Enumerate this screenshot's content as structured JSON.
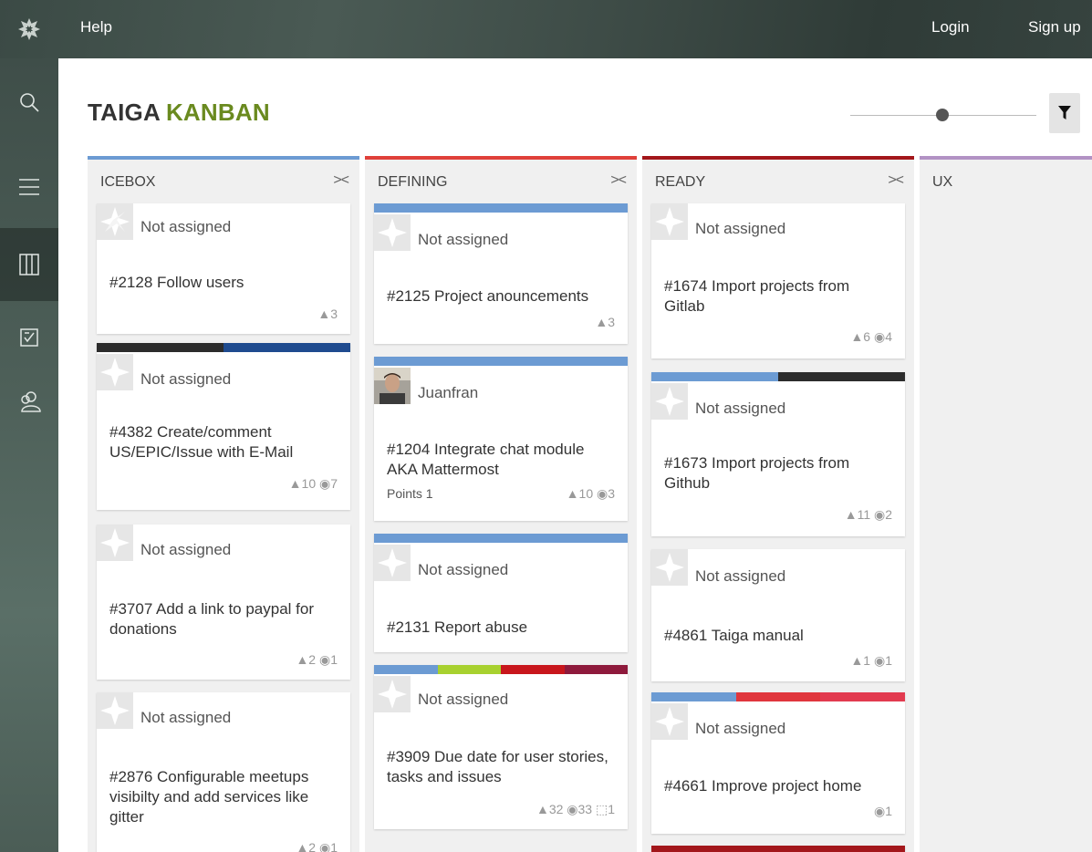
{
  "topbar": {
    "help": "Help",
    "login": "Login",
    "signup": "Sign up"
  },
  "project": {
    "name": "TAIGA",
    "section": "KANBAN"
  },
  "columns": [
    {
      "name": "ICEBOX",
      "color": "#6c9bd3"
    },
    {
      "name": "DEFINING",
      "color": "#e0403a"
    },
    {
      "name": "READY",
      "color": "#a3171b"
    },
    {
      "name": "UX",
      "color": "#b292c4"
    }
  ],
  "fold_symbol": "><",
  "cards": {
    "c1": {
      "assignee": "Not assigned",
      "subject": "#2128 Follow users",
      "stats": "▲3"
    },
    "c2": {
      "assignee": "Not assigned",
      "subject": "#4382 Create/comment US/EPIC/Issue with E-Mail",
      "stats": "▲10 ◉7"
    },
    "c3": {
      "assignee": "Not assigned",
      "subject": "#3707 Add a link to paypal for donations",
      "stats": "▲2 ◉1"
    },
    "c4": {
      "assignee": "Not assigned",
      "subject": "#2876 Configurable meetups visibilty and add services like gitter",
      "stats": "▲2 ◉1"
    },
    "d1": {
      "assignee": "Not assigned",
      "subject": "#2125 Project anouncements",
      "stats": "▲3"
    },
    "d2": {
      "assignee": "Juanfran",
      "subject": "#1204 Integrate chat module AKA Mattermost",
      "points": "Points 1",
      "stats": "▲10 ◉3"
    },
    "d3": {
      "assignee": "Not assigned",
      "subject": "#2131 Report abuse"
    },
    "d4": {
      "assignee": "Not assigned",
      "subject": "#3909 Due date for user stories, tasks and issues",
      "stats": "▲32 ◉33 ⬚1"
    },
    "r1": {
      "assignee": "Not assigned",
      "subject": "#1674 Import projects from Gitlab",
      "stats": "▲6 ◉4"
    },
    "r2": {
      "assignee": "Not assigned",
      "subject": "#1673 Import projects from Github",
      "stats": "▲11 ◉2"
    },
    "r3": {
      "assignee": "Not assigned",
      "subject": "#4861 Taiga manual",
      "stats": "▲1 ◉1"
    },
    "r4": {
      "assignee": "Not assigned",
      "subject": "#4661 Improve project home",
      "stats": "◉1"
    }
  },
  "tag_colors": {
    "blue": "#6c9bd3",
    "dark": "#2c2c2c",
    "navy": "#1f4b8f",
    "lime": "#a8d12f",
    "red": "#c8161c",
    "maroon": "#8e1a3c",
    "bright_red": "#e0363d",
    "pinkred": "#e23a4f"
  },
  "icons": {
    "logo": "taiga-logo-icon",
    "search": "search-icon",
    "backlog": "backlog-icon",
    "kanban": "kanban-icon",
    "issues": "issues-icon",
    "team": "team-icon",
    "filter": "filter-icon"
  }
}
